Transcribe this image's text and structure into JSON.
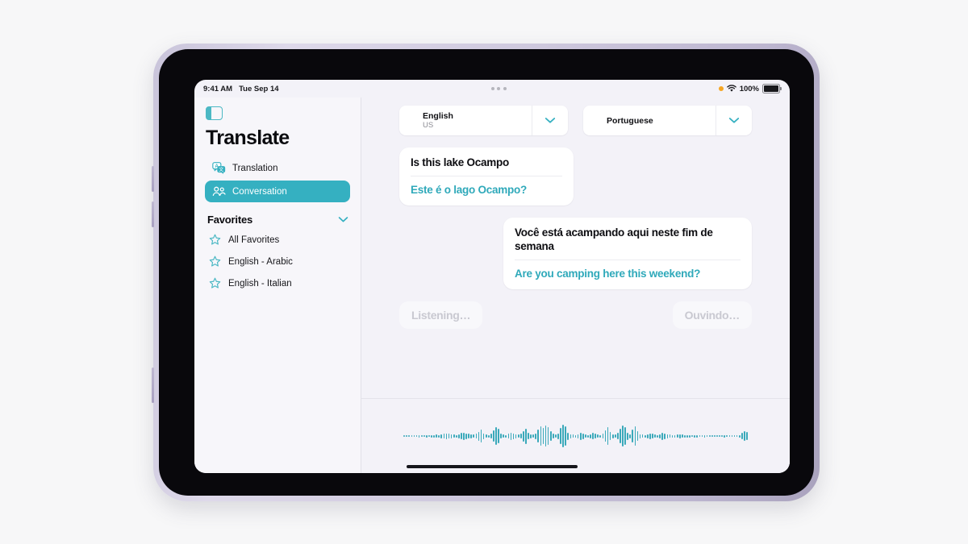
{
  "device": {
    "frame_color": "#cfc9de",
    "bezel_color": "#09080c",
    "screen_bg": "#f3f2f8"
  },
  "accent_color": "#35b0c1",
  "status_bar": {
    "time": "9:41 AM",
    "date": "Tue Sep 14",
    "mic_indicator_icon": "orange-dot-icon",
    "wifi_icon": "wifi-icon",
    "battery_percent": "100%",
    "battery_icon": "battery-full-icon",
    "multitask_icon": "three-dots-icon"
  },
  "sidebar": {
    "toggle_icon": "sidebar-toggle-icon",
    "title": "Translate",
    "nav_items": [
      {
        "label": "Translation",
        "icon": "translate-icon",
        "selected": false
      },
      {
        "label": "Conversation",
        "icon": "two-people-icon",
        "selected": true
      }
    ],
    "favorites": {
      "label": "Favorites",
      "chevron_icon": "chevron-down-icon",
      "items": [
        {
          "label": "All Favorites",
          "icon": "star-icon"
        },
        {
          "label": "English - Arabic",
          "icon": "star-icon"
        },
        {
          "label": "English - Italian",
          "icon": "star-icon"
        }
      ]
    }
  },
  "main": {
    "language_selectors": [
      {
        "primary": "English",
        "secondary": "US",
        "chevron_icon": "chevron-down-icon"
      },
      {
        "primary": "Portuguese",
        "secondary": "",
        "chevron_icon": "chevron-down-icon"
      }
    ],
    "messages": [
      {
        "side": "left",
        "source": "Is this lake Ocampo",
        "translation": "Este é o lago Ocampo?"
      },
      {
        "side": "right",
        "source": "Você está acampando aqui neste fim de semana",
        "translation": "Are you camping here this weekend?"
      }
    ],
    "listening_left": "Listening…",
    "listening_right": "Ouvindo…"
  },
  "waveform": {
    "color": "#3aa9ba",
    "amplitudes": [
      2,
      2,
      2,
      2,
      2,
      2,
      3,
      2,
      2,
      3,
      2,
      3,
      3,
      4,
      3,
      5,
      6,
      7,
      6,
      5,
      4,
      3,
      5,
      8,
      9,
      7,
      6,
      5,
      4,
      6,
      11,
      16,
      7,
      4,
      3,
      6,
      14,
      22,
      18,
      6,
      4,
      3,
      6,
      9,
      7,
      5,
      4,
      6,
      13,
      19,
      8,
      5,
      4,
      7,
      16,
      24,
      20,
      26,
      22,
      12,
      6,
      4,
      7,
      20,
      28,
      24,
      9,
      5,
      4,
      3,
      5,
      9,
      7,
      4,
      3,
      5,
      8,
      6,
      4,
      3,
      6,
      14,
      22,
      10,
      5,
      4,
      8,
      18,
      26,
      22,
      9,
      5,
      16,
      24,
      12,
      5,
      4,
      3,
      5,
      7,
      6,
      4,
      3,
      5,
      9,
      7,
      5,
      4,
      3,
      3,
      4,
      5,
      4,
      3,
      3,
      3,
      2,
      3,
      3,
      2,
      2,
      3,
      2,
      2,
      2,
      2,
      2,
      2,
      2,
      3,
      2,
      2,
      2,
      2,
      2,
      3,
      8,
      12,
      10
    ]
  },
  "home_indicator": "home-indicator-bar"
}
